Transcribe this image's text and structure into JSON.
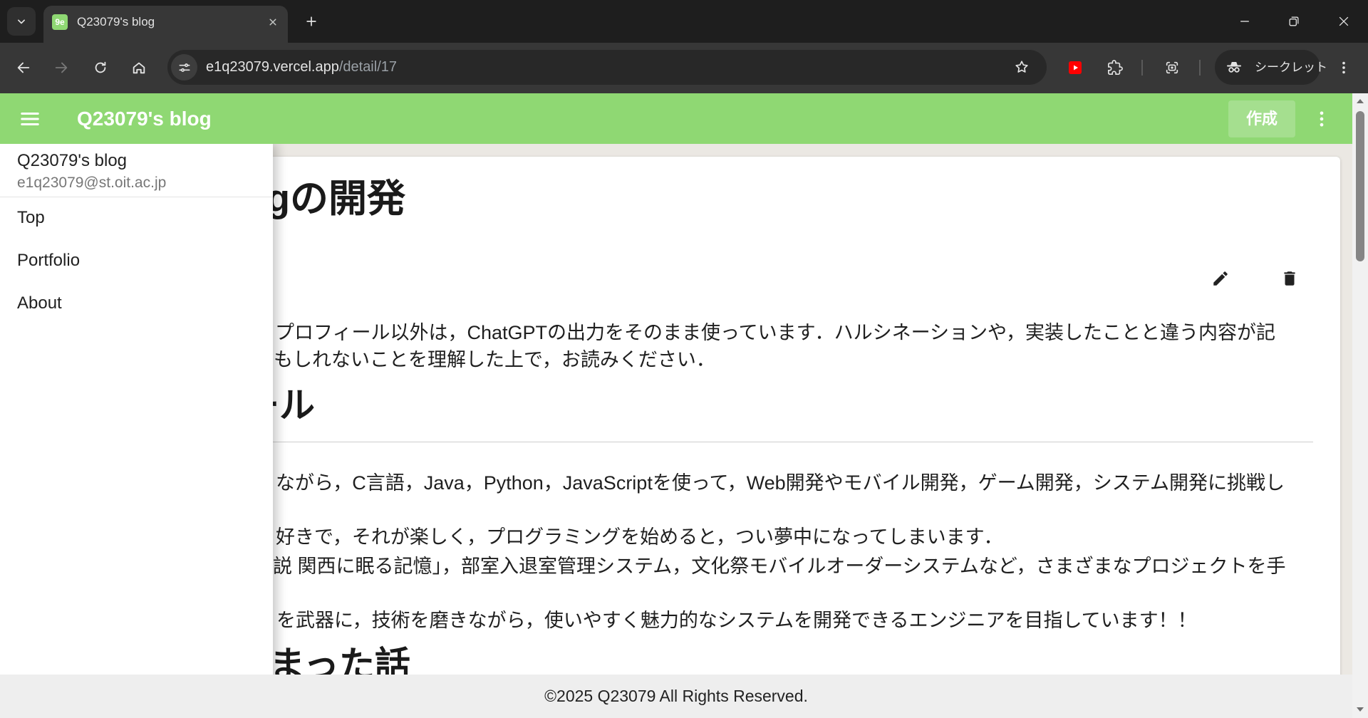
{
  "browser": {
    "tab": {
      "favicon_text": "9e",
      "title": "Q23079's blog"
    },
    "address": {
      "host": "e1q23079.vercel.app",
      "path": "/detail/17"
    },
    "forward_enabled": false,
    "incognito_label": "シークレット",
    "icons": {
      "tab_strip": [
        "chevron-down-icon",
        "close-icon",
        "plus-icon",
        "minimize-icon",
        "restore-icon",
        "window-close-icon"
      ],
      "toolbar": [
        "back-arrow-icon",
        "forward-arrow-icon",
        "reload-icon",
        "home-icon",
        "site-info-icon",
        "star-icon",
        "youtube-extension-icon",
        "puzzle-extension-icon",
        "screen-capture-icon",
        "incognito-icon",
        "more-vert-icon"
      ]
    }
  },
  "appbar": {
    "title": "Q23079's blog",
    "create_label": "作成",
    "icons": [
      "menu-icon",
      "more-vert-icon"
    ]
  },
  "drawer": {
    "header_title": "Q23079's blog",
    "email": "e1q23079@st.oit.ac.jp",
    "items": [
      {
        "label": "Top"
      },
      {
        "label": "Portfolio"
      },
      {
        "label": "About"
      }
    ]
  },
  "article": {
    "title": "gの開発",
    "icons": [
      "pencil-icon",
      "trash-icon"
    ],
    "intro_lines": [
      "プロフィール以外は，ChatGPTの出力をそのまま使っています．ハルシネーションや，実装したことと違う内容が記",
      "もしれないことを理解した上で，お読みください．"
    ],
    "section_heading": "ール",
    "profile_lines": [
      "ながら，C言語，Java，Python，JavaScriptを使って，Web開発やモバイル開発，ゲーム開発，システム開発に挑戦し",
      "好きで，それが楽しく，プログラミングを始めると，つい夢中になってしまいます．",
      "説 関西に眠る記憶」，部室入退室管理システム，文化祭モバイルオーダーシステムなど，さまざまなプロジェクトを手",
      "を武器に，技術を磨きながら，使いやすく魅力的なシステムを開発できるエンジニアを目指しています！！"
    ],
    "next_heading": "まった話"
  },
  "footer": {
    "copyright": "©2025 Q23079 All Rights Reserved."
  },
  "colors": {
    "tab_strip": "#1e1e1e",
    "toolbar": "#373737",
    "omnibox": "#282828",
    "appbar": "#8fd873",
    "page_background": "#ebe8e3",
    "footer": "#eeeeee",
    "youtube_red": "#ff0000"
  }
}
